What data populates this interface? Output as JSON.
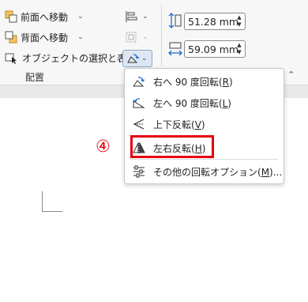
{
  "ribbon": {
    "bring_forward": "前面へ移動",
    "send_backward": "背面へ移動",
    "selection_pane": "オブジェクトの選択と表示",
    "group_label": "配置",
    "height_value": "51.28 mm",
    "width_value": "59.09 mm"
  },
  "rotate_menu": {
    "items": [
      {
        "label": "右へ 90 度回転(",
        "key": "R",
        "suffix": ")"
      },
      {
        "label": "左へ 90 度回転(",
        "key": "L",
        "suffix": ")"
      },
      {
        "label": "上下反転(",
        "key": "V",
        "suffix": ")"
      },
      {
        "label": "左右反転(",
        "key": "H",
        "suffix": ")"
      },
      {
        "label": "その他の回転オプション(",
        "key": "M",
        "suffix": ")..."
      }
    ]
  },
  "annotation": {
    "step_number": "④",
    "color": "#e3000f"
  }
}
